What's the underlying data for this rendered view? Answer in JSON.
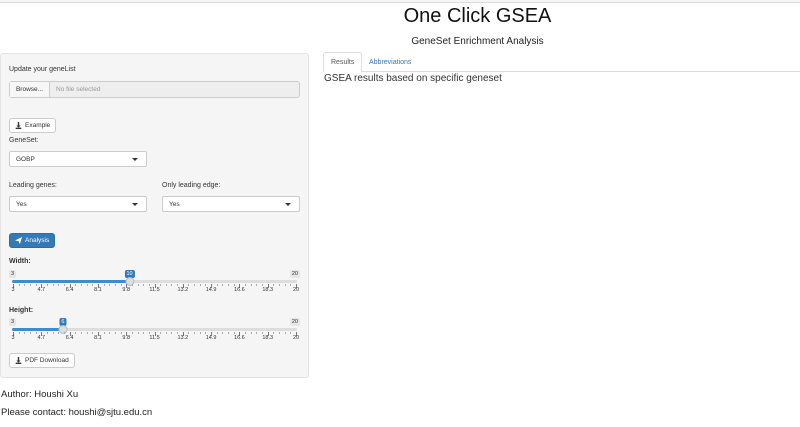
{
  "header": {
    "title": "One Click GSEA",
    "subtitle": "GeneSet Enrichment Analysis"
  },
  "sidebar": {
    "upload_label": "Update your geneList",
    "browse_label": "Browse...",
    "file_placeholder": "No file selected",
    "example_label": "Example",
    "geneset_label": "GeneSet:",
    "geneset_value": "GOBP",
    "leading_genes_label": "Leading genes:",
    "leading_genes_value": "Yes",
    "only_leading_edge_label": "Only leading edge:",
    "only_leading_edge_value": "Yes",
    "analysis_label": "Analysis",
    "width_slider": {
      "label": "Width:",
      "min": 3,
      "max": 20,
      "value": 10,
      "min_label": "3",
      "max_label": "20",
      "value_label": "10",
      "ticks": [
        "3",
        "4.7",
        "6.4",
        "8.1",
        "9.8",
        "11.5",
        "13.2",
        "14.9",
        "16.6",
        "18.3",
        "20"
      ]
    },
    "height_slider": {
      "label": "Height:",
      "min": 3,
      "max": 20,
      "value": 6,
      "min_label": "3",
      "max_label": "20",
      "value_label": "6",
      "ticks": [
        "3",
        "4.7",
        "6.4",
        "8.1",
        "9.8",
        "11.5",
        "13.2",
        "14.9",
        "16.6",
        "18.3",
        "20"
      ]
    },
    "pdf_download_label": "PDF Download"
  },
  "tabs": [
    {
      "label": "Results",
      "active": true
    },
    {
      "label": "Abbreviations",
      "active": false
    }
  ],
  "main": {
    "heading": "GSEA results based on specific geneset"
  },
  "footer": {
    "author": "Author: Houshi Xu",
    "contact": "Please contact: houshi@sjtu.edu.cn"
  },
  "colors": {
    "primary": "#337ab7",
    "slider_fill": "#428bca",
    "panel_bg": "#f5f5f5"
  },
  "icons": {
    "example": "download-icon",
    "analysis": "paper-plane-icon",
    "pdf": "download-icon"
  }
}
